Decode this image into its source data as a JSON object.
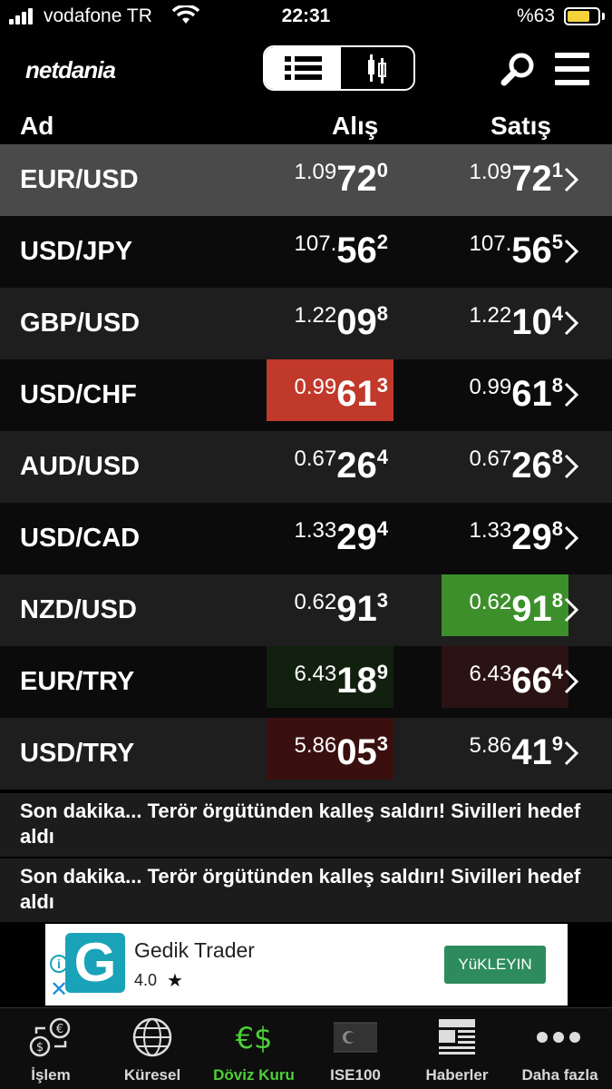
{
  "status_bar": {
    "carrier": "vodafone TR",
    "time": "22:31",
    "battery": "%63"
  },
  "header": {
    "logo": "netdania",
    "colors": {
      "accent": "#ffffff"
    }
  },
  "table": {
    "columns": {
      "name": "Ad",
      "bid": "Alış",
      "ask": "Satış"
    },
    "rows": [
      {
        "pair": "EUR/USD",
        "bid": {
          "pre": "1.09",
          "big": "72",
          "sup": "0"
        },
        "ask": {
          "pre": "1.09",
          "big": "72",
          "sup": "1"
        }
      },
      {
        "pair": "USD/JPY",
        "bid": {
          "pre": "107.",
          "big": "56",
          "sup": "2"
        },
        "ask": {
          "pre": "107.",
          "big": "56",
          "sup": "5"
        }
      },
      {
        "pair": "GBP/USD",
        "bid": {
          "pre": "1.22",
          "big": "09",
          "sup": "8"
        },
        "ask": {
          "pre": "1.22",
          "big": "10",
          "sup": "4"
        }
      },
      {
        "pair": "USD/CHF",
        "bid": {
          "pre": "0.99",
          "big": "61",
          "sup": "3"
        },
        "ask": {
          "pre": "0.99",
          "big": "61",
          "sup": "8"
        }
      },
      {
        "pair": "AUD/USD",
        "bid": {
          "pre": "0.67",
          "big": "26",
          "sup": "4"
        },
        "ask": {
          "pre": "0.67",
          "big": "26",
          "sup": "8"
        }
      },
      {
        "pair": "USD/CAD",
        "bid": {
          "pre": "1.33",
          "big": "29",
          "sup": "4"
        },
        "ask": {
          "pre": "1.33",
          "big": "29",
          "sup": "8"
        }
      },
      {
        "pair": "NZD/USD",
        "bid": {
          "pre": "0.62",
          "big": "91",
          "sup": "3"
        },
        "ask": {
          "pre": "0.62",
          "big": "91",
          "sup": "8"
        }
      },
      {
        "pair": "EUR/TRY",
        "bid": {
          "pre": "6.43",
          "big": "18",
          "sup": "9"
        },
        "ask": {
          "pre": "6.43",
          "big": "66",
          "sup": "4"
        }
      },
      {
        "pair": "USD/TRY",
        "bid": {
          "pre": "5.86",
          "big": "05",
          "sup": "3"
        },
        "ask": {
          "pre": "5.86",
          "big": "41",
          "sup": "9"
        }
      }
    ],
    "highlight_colors": {
      "down": "#c0392b",
      "up": "#3d8f2c"
    }
  },
  "news": [
    "Son dakika... Terör örgütünden kalleş saldırı! Sivilleri hedef aldı",
    "Son dakika... Terör örgütünden kalleş saldırı! Sivilleri hedef aldı"
  ],
  "ad": {
    "icon_letter": "G",
    "title": "Gedik Trader",
    "rating": "4.0",
    "cta": "YüKLEYIN"
  },
  "tabs": [
    {
      "label": "İşlem",
      "icon": "exchange-icon"
    },
    {
      "label": "Küresel",
      "icon": "globe-icon"
    },
    {
      "label": "Döviz Kuru",
      "icon": "currency-icon",
      "active": true
    },
    {
      "label": "ISE100",
      "icon": "turkey-flag-icon"
    },
    {
      "label": "Haberler",
      "icon": "newspaper-icon"
    },
    {
      "label": "Daha fazla",
      "icon": "more-icon"
    }
  ]
}
